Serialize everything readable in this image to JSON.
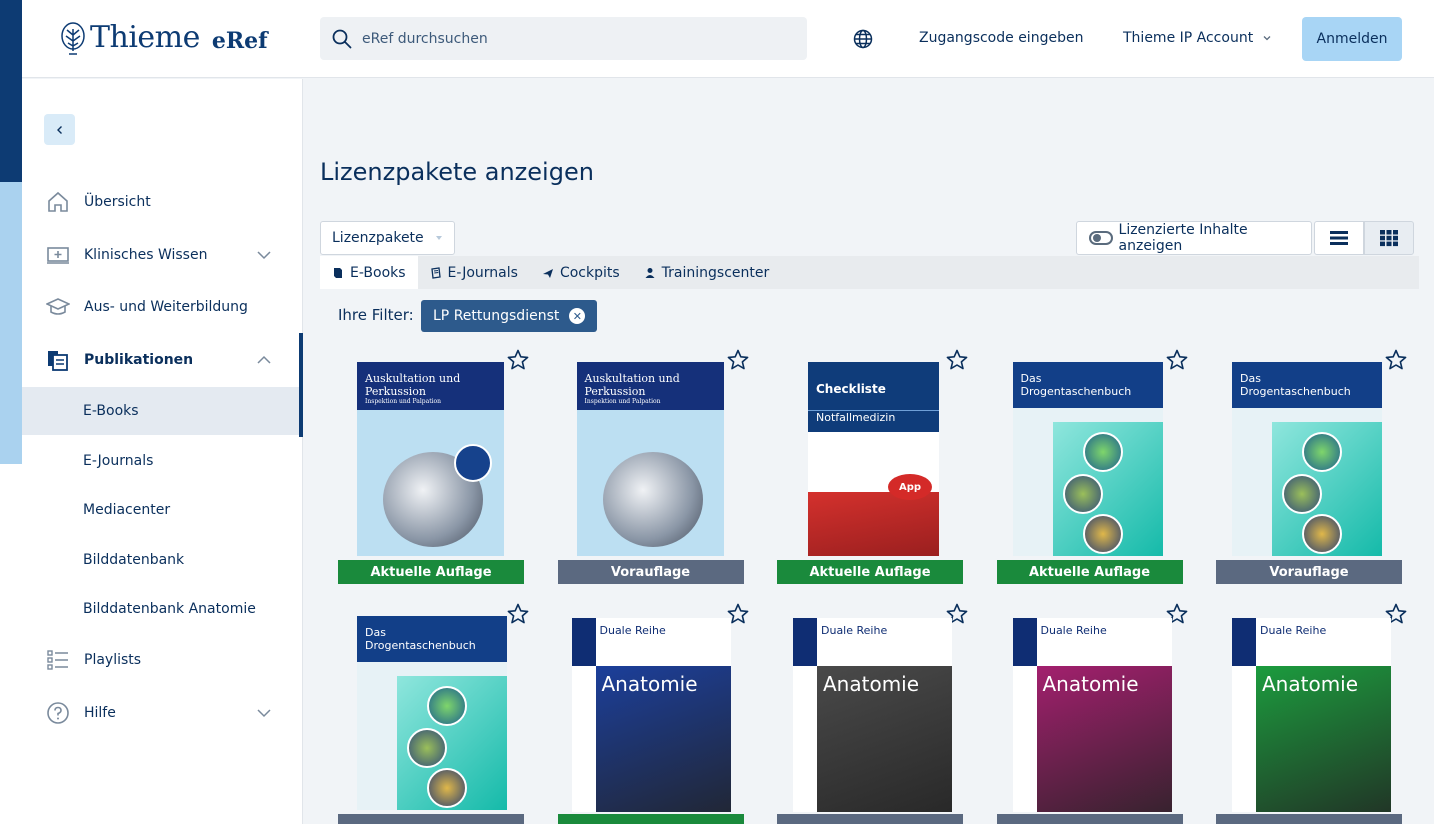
{
  "header": {
    "brand": "Thieme",
    "product": "eRef",
    "search_placeholder": "eRef durchsuchen",
    "access_code_link": "Zugangscode eingeben",
    "ip_account_link": "Thieme IP Account",
    "login_button": "Anmelden"
  },
  "sidebar": {
    "items": [
      {
        "label": "Übersicht",
        "icon": "home-icon"
      },
      {
        "label": "Klinisches Wissen",
        "icon": "clinical-icon"
      },
      {
        "label": "Aus- und Weiterbildung",
        "icon": "graduation-icon"
      },
      {
        "label": "Publikationen",
        "icon": "publications-icon"
      },
      {
        "label": "Playlists",
        "icon": "playlist-icon"
      },
      {
        "label": "Hilfe",
        "icon": "help-icon"
      }
    ],
    "sub_items": [
      "E-Books",
      "E-Journals",
      "Mediacenter",
      "Bilddatenbank",
      "Bilddatenbank Anatomie"
    ]
  },
  "main": {
    "title": "Lizenzpakete anzeigen",
    "dropdown_value": "Lizenzpakete",
    "toggle_label": "Lizenzierte Inhalte anzeigen",
    "tabs": [
      "E-Books",
      "E-Journals",
      "Cockpits",
      "Trainingscenter"
    ],
    "filter_label": "Ihre Filter:",
    "filter_chip": "LP Rettungsdienst"
  },
  "cards": [
    {
      "type": "ausk",
      "title": "Auskultation und Perkussion",
      "subtitle": "Inspektion und Palpation",
      "badge": "Aktuelle Auflage",
      "status": "green"
    },
    {
      "type": "ausk",
      "title": "Auskultation und Perkussion",
      "subtitle": "Inspektion und Palpation",
      "badge": "Vorauflage",
      "status": "gray"
    },
    {
      "type": "check",
      "title": "Checkliste",
      "subtitle": "Notfallmedizin",
      "app": "App",
      "badge": "Aktuelle Auflage",
      "status": "green"
    },
    {
      "type": "drog",
      "title": "Das Drogentaschenbuch",
      "badge": "Aktuelle Auflage",
      "status": "green"
    },
    {
      "type": "drog",
      "title": "Das Drogentaschenbuch",
      "badge": "Vorauflage",
      "status": "gray"
    },
    {
      "type": "drog",
      "title": "Das Drogentaschenbuch",
      "badge": "",
      "status": "gray"
    },
    {
      "type": "dual",
      "series": "Duale Reihe",
      "title": "Anatomie",
      "badge": "",
      "status": "green",
      "img": "#1c3f9b"
    },
    {
      "type": "dual",
      "series": "Duale Reihe",
      "title": "Anatomie",
      "badge": "",
      "status": "gray",
      "img": "#4a4a4a"
    },
    {
      "type": "dual",
      "series": "Duale Reihe",
      "title": "Anatomie",
      "badge": "",
      "status": "gray",
      "img": "#a3206e"
    },
    {
      "type": "dual",
      "series": "Duale Reihe",
      "title": "Anatomie",
      "badge": "",
      "status": "gray",
      "img": "#1c9c3e"
    }
  ]
}
